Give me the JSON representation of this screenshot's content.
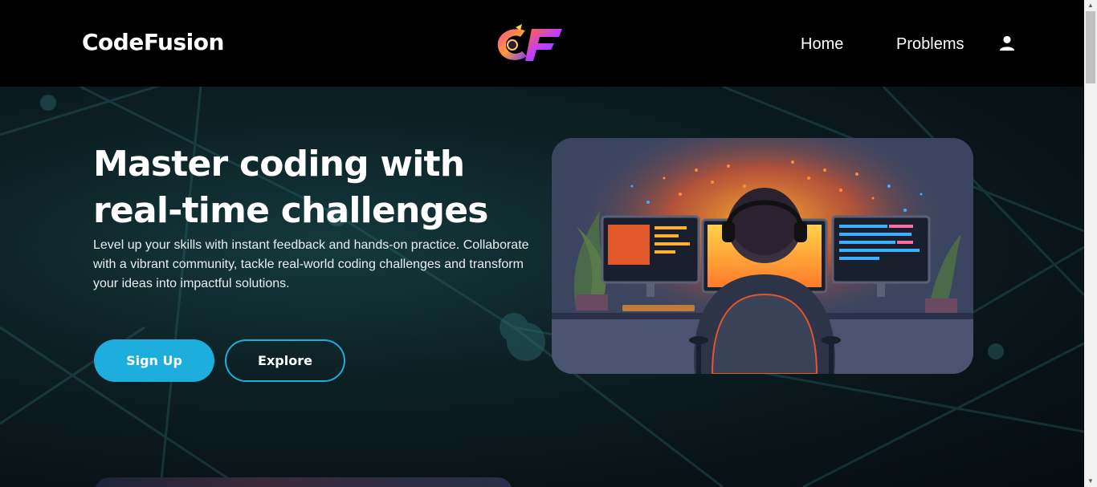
{
  "navbar": {
    "brand": "CodeFusion",
    "logo_icon": "cf-logo-icon",
    "links": [
      {
        "label": "Home"
      },
      {
        "label": "Problems"
      }
    ],
    "user_icon": "user-icon"
  },
  "hero": {
    "headline_line1": "Master coding with",
    "headline_line2": "real-time challenges",
    "subtext": "Level up your skills with instant feedback and hands-on practice. Collaborate with a vibrant community, tackle real-world coding challenges and transform your ideas into impactful solutions.",
    "signup_label": "Sign Up",
    "explore_label": "Explore",
    "image_icon": "coder-at-desk-illustration"
  },
  "colors": {
    "accent": "#1eaede",
    "nav_bg": "#000000",
    "hero_bg": "#0d2226"
  }
}
